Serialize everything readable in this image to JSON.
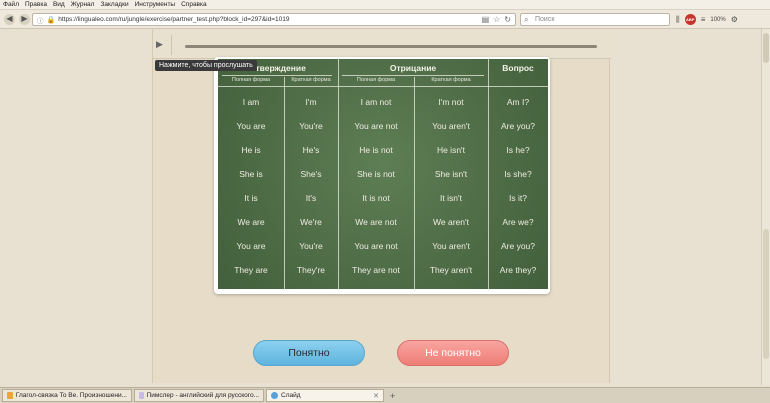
{
  "menu": [
    "Файл",
    "Правка",
    "Вид",
    "Журнал",
    "Закладки",
    "Инструменты",
    "Справка"
  ],
  "nav": {
    "url": "https://lingualeo.com/ru/jungle/exercise/partner_test.php?block_id=297&id=1019",
    "search_placeholder": "Поиск",
    "zoom": "100%"
  },
  "audio": {
    "tooltip": "Нажмите, чтобы прослушать"
  },
  "table": {
    "headers": [
      "Утверждение",
      "Отрицание",
      "Вопрос"
    ],
    "subheaders": [
      "Полная форма",
      "Краткая форма",
      "Полная форма",
      "Краткая форма"
    ],
    "rows": [
      [
        "I am",
        "I'm",
        "I am not",
        "I'm not",
        "Am I?"
      ],
      [
        "You are",
        "You're",
        "You are not",
        "You aren't",
        "Are you?"
      ],
      [
        "He is",
        "He's",
        "He is not",
        "He isn't",
        "Is he?"
      ],
      [
        "She is",
        "She's",
        "She is not",
        "She isn't",
        "Is she?"
      ],
      [
        "It is",
        "It's",
        "It is not",
        "It isn't",
        "Is it?"
      ],
      [
        "We are",
        "We're",
        "We are not",
        "We aren't",
        "Are we?"
      ],
      [
        "You are",
        "You're",
        "You are not",
        "You aren't",
        "Are you?"
      ],
      [
        "They are",
        "They're",
        "They are not",
        "They aren't",
        "Are they?"
      ]
    ]
  },
  "buttons": {
    "understood": "Понятно",
    "not_understood": "Не понятно"
  },
  "taskbar": [
    {
      "label": "Глагол-связка To Be. Произношени..."
    },
    {
      "label": "Пимслер - английский для русского..."
    },
    {
      "label": "Слайд"
    }
  ],
  "colors": {
    "board": "#4f6e47",
    "ok_button": "#6fc0e6",
    "no_button": "#f28a84"
  }
}
